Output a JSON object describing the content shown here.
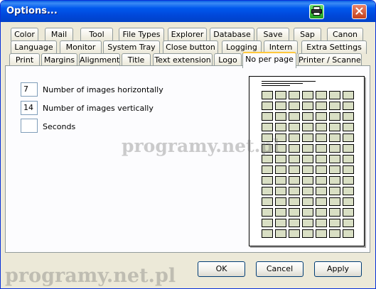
{
  "window": {
    "title": "Options..."
  },
  "tabs": {
    "row1": [
      "Color",
      "Mail",
      "Tool",
      "File Types",
      "Explorer",
      "Database",
      "Save",
      "Sap",
      "Canon"
    ],
    "row2": [
      "Language",
      "Monitor",
      "System Tray",
      "Close button",
      "Logging",
      "Intern",
      "Extra Settings"
    ],
    "row3": [
      "Print",
      "Margins",
      "Alignment",
      "Title",
      "Text extension",
      "Logo",
      "No per page",
      "Printer / Scanner"
    ],
    "active": "No per page"
  },
  "fields": {
    "horizontal": {
      "value": "7",
      "label": "Number of images horizontally"
    },
    "vertical": {
      "value": "14",
      "label": "Number of images vertically"
    },
    "seconds": {
      "value": "",
      "label": "Seconds"
    }
  },
  "preview": {
    "columns": 7,
    "rows": 14
  },
  "buttons": {
    "ok": "OK",
    "cancel": "Cancel",
    "apply": "Apply"
  },
  "watermark": {
    "text": "programy.net.pl"
  },
  "colors": {
    "titlebar": "#0054e3",
    "active_tab_accent": "#ffc83c",
    "cell_fill": "#d9dfc4"
  }
}
